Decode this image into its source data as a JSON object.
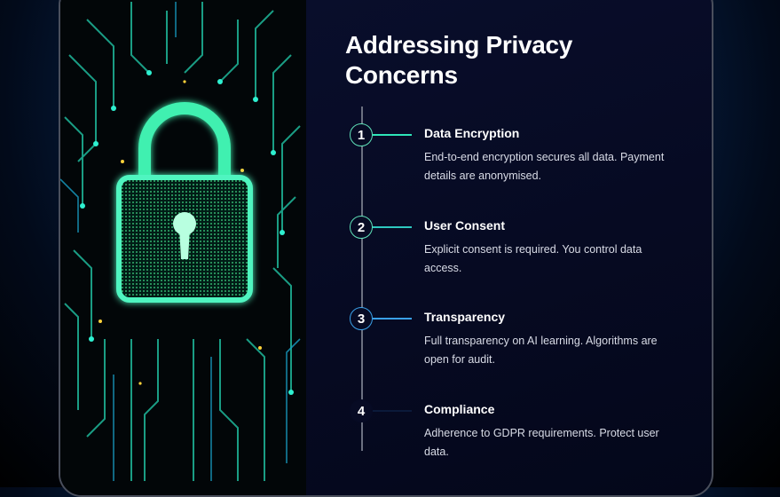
{
  "title": "Addressing Privacy Concerns",
  "steps": [
    {
      "number": "1",
      "title": "Data Encryption",
      "description": "End-to-end encryption secures all data. Payment details are anonymised.",
      "accent": "#2ee6b8"
    },
    {
      "number": "2",
      "title": "User Consent",
      "description": "Explicit consent is required. You control data access.",
      "accent": "#2ec9c0"
    },
    {
      "number": "3",
      "title": "Transparency",
      "description": "Full transparency on AI learning. Algorithms are open for audit.",
      "accent": "#3aa0e8"
    },
    {
      "number": "4",
      "title": "Compliance",
      "description": "Adherence to GDPR requirements. Protect user data.",
      "accent": "#0b1a3a"
    }
  ],
  "illustration": {
    "icon": "padlock-icon",
    "accent": "#2ef0b0"
  }
}
